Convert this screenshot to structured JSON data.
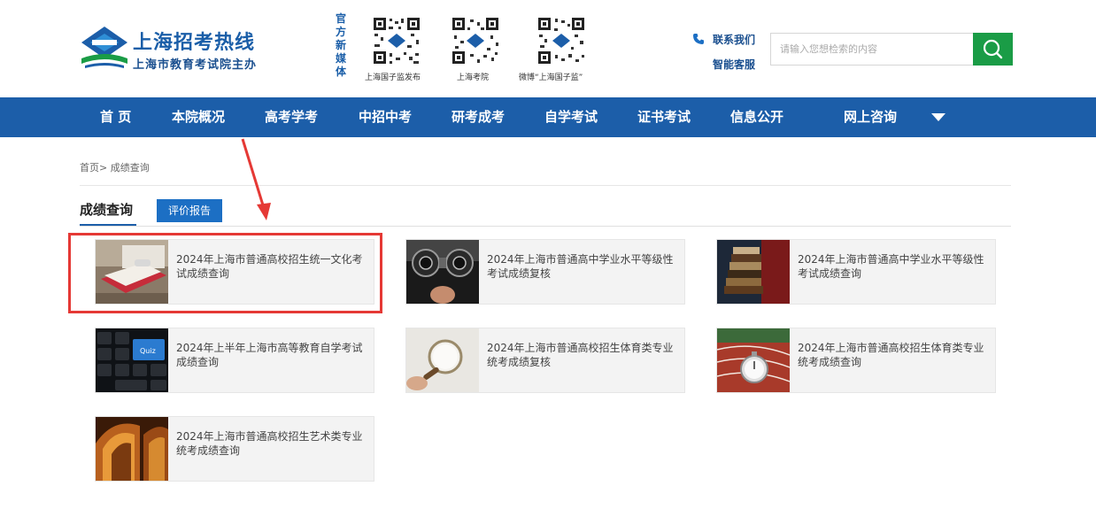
{
  "header": {
    "logo_title": "上海招考热线",
    "logo_subtitle": "上海市教育考试院主办",
    "media_label": "官方新媒体",
    "qr_codes": [
      {
        "caption": "上海国子监发布"
      },
      {
        "caption": "上海考院"
      },
      {
        "caption": "微博“上海国子监”"
      }
    ],
    "contact_us": "联系我们",
    "smart_service": "智能客服",
    "search_placeholder": "请输入您想检索的内容",
    "search_icon": "search-icon",
    "phone_icon": "phone-icon"
  },
  "nav": {
    "items": [
      {
        "label": "首 页"
      },
      {
        "label": "本院概况"
      },
      {
        "label": "高考学考"
      },
      {
        "label": "中招中考"
      },
      {
        "label": "研考成考"
      },
      {
        "label": "自学考试"
      },
      {
        "label": "证书考试"
      },
      {
        "label": "信息公开"
      },
      {
        "label": "网上咨询"
      }
    ]
  },
  "breadcrumb": {
    "home": "首页",
    "separator": ">",
    "current": " 成绩查询"
  },
  "tabs": {
    "active": "成绩查询",
    "other": "评价报告"
  },
  "cards": [
    {
      "title": "2024年上海市普通高校招生统一文化考试成绩查询",
      "image": "book-image"
    },
    {
      "title": "2024年上海市普通高中学业水平等级性考试成绩复核",
      "image": "optometry-image"
    },
    {
      "title": "2024年上海市普通高中学业水平等级性考试成绩查询",
      "image": "books-stack-image"
    },
    {
      "title": "2024年上半年上海市高等教育自学考试成绩查询",
      "image": "keyboard-image"
    },
    {
      "title": "2024年上海市普通高校招生体育类专业统考成绩复核",
      "image": "magnifier-image"
    },
    {
      "title": "2024年上海市普通高校招生体育类专业统考成绩查询",
      "image": "stopwatch-image"
    },
    {
      "title": "2024年上海市普通高校招生艺术类专业统考成绩查询",
      "image": "arches-image"
    }
  ],
  "colors": {
    "brand_blue": "#1c5ea9",
    "search_green": "#1a9c46",
    "highlight_red": "#e53935"
  }
}
